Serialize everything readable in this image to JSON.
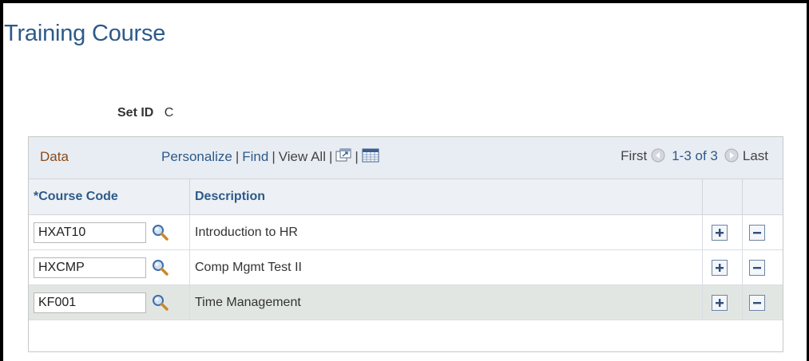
{
  "page": {
    "title": "Training Course"
  },
  "set_id": {
    "label": "Set ID",
    "value": "C"
  },
  "grid": {
    "title": "Data",
    "links": {
      "personalize": "Personalize",
      "find": "Find",
      "view_all": "View All"
    },
    "pager": {
      "first": "First",
      "range": "1-3 of 3",
      "last": "Last"
    },
    "columns": {
      "course_code": "*Course Code",
      "description": "Description"
    },
    "rows": [
      {
        "code": "HXAT10",
        "description": "Introduction to HR"
      },
      {
        "code": "HXCMP",
        "description": "Comp Mgmt Test II"
      },
      {
        "code": "KF001",
        "description": "Time Management"
      }
    ]
  },
  "colors": {
    "title_blue": "#2d5a8a",
    "header_bg": "#e8edf3",
    "highlight_row": "#e2e6e3"
  }
}
